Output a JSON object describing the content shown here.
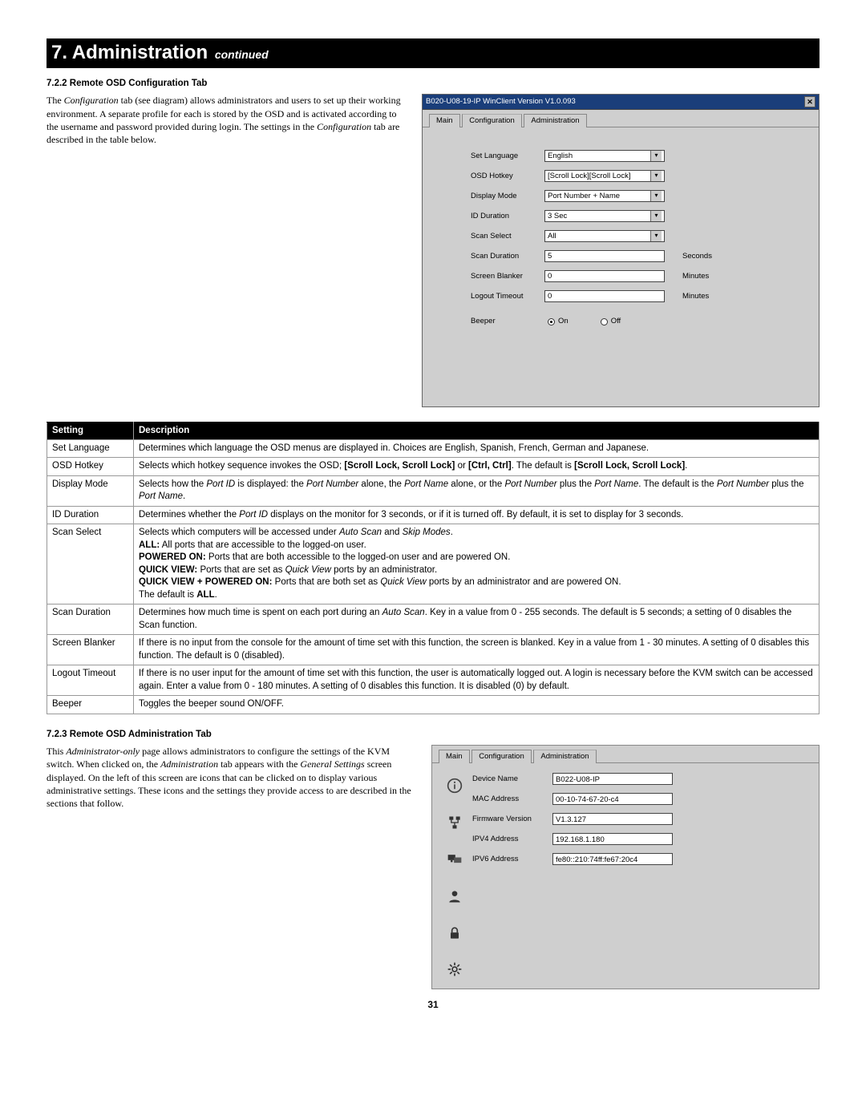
{
  "header": {
    "title": "7. Administration",
    "subtitle": "continued"
  },
  "section1": {
    "heading": "7.2.2 Remote OSD Configuration Tab",
    "paragraph_html": "The <span class=\"ital\">Configuration</span> tab (see diagram) allows administrators and users to set up their working environment. A separate profile for each is stored by the OSD and is activated according to the username and password provided during login. The settings in the <span class=\"ital\">Configuration</span> tab are described in the table below."
  },
  "winclient": {
    "title": "B020-U08-19-IP WinClient Version V1.0.093",
    "tabs": [
      "Main",
      "Configuration",
      "Administration"
    ],
    "active_tab": 1,
    "fields": {
      "set_language": {
        "label": "Set Language",
        "value": "English",
        "type": "select"
      },
      "osd_hotkey": {
        "label": "OSD Hotkey",
        "value": "[Scroll Lock][Scroll Lock]",
        "type": "select"
      },
      "display_mode": {
        "label": "Display Mode",
        "value": "Port Number + Name",
        "type": "select"
      },
      "id_duration": {
        "label": "ID Duration",
        "value": "3 Sec",
        "type": "select"
      },
      "scan_select": {
        "label": "Scan Select",
        "value": "All",
        "type": "select"
      },
      "scan_duration": {
        "label": "Scan Duration",
        "value": "5",
        "type": "input",
        "suffix": "Seconds"
      },
      "screen_blanker": {
        "label": "Screen Blanker",
        "value": "0",
        "type": "input",
        "suffix": "Minutes"
      },
      "logout_timeout": {
        "label": "Logout Timeout",
        "value": "0",
        "type": "input",
        "suffix": "Minutes"
      },
      "beeper": {
        "label": "Beeper",
        "type": "radio",
        "value": "On",
        "options": [
          "On",
          "Off"
        ]
      }
    }
  },
  "settings_table": {
    "headers": [
      "Setting",
      "Description"
    ],
    "rows": [
      {
        "setting": "Set Language",
        "description_html": "Determines which language the OSD menus are displayed in. Choices are English, Spanish, French, German and Japanese."
      },
      {
        "setting": "OSD Hotkey",
        "description_html": "Selects which hotkey sequence invokes the OSD; <b>[Scroll Lock, Scroll Lock]</b> or <b>[Ctrl, Ctrl]</b>. The default is <b>[Scroll Lock, Scroll Lock]</b>."
      },
      {
        "setting": "Display Mode",
        "description_html": "Selects how the <i>Port ID</i> is displayed: the <i>Port Number</i> alone, the <i>Port Name</i> alone, or the <i>Port Number</i> plus the <i>Port Name</i>. The default is the <i>Port Number</i> plus the <i>Port Name</i>."
      },
      {
        "setting": "ID Duration",
        "description_html": "Determines whether the <i>Port ID</i> displays on the monitor for 3 seconds, or if it is turned off. By default, it is set to display for 3 seconds."
      },
      {
        "setting": "Scan Select",
        "description_html": "Selects which computers will be accessed under <i>Auto Scan</i> and <i>Skip Modes</i>.<br><b>ALL:</b> All ports that are accessible to the logged-on user.<br><b>POWERED ON:</b> Ports that are both accessible to the logged-on user and are powered ON.<br><b>QUICK VIEW:</b> Ports that are set as <i>Quick View</i> ports by an administrator.<br><b>QUICK VIEW + POWERED ON:</b> Ports that are both set as <i>Quick View</i> ports by an administrator and are powered ON.<br>The default is <b>ALL</b>."
      },
      {
        "setting": "Scan Duration",
        "description_html": "Determines how much time is spent on each port during an <i>Auto Scan</i>. Key in a value from 0 - 255 seconds. The default is 5 seconds; a setting of 0 disables the Scan function."
      },
      {
        "setting": "Screen Blanker",
        "description_html": "If there is no input from the console for the amount of time set with this function, the screen is blanked. Key in a value from 1 - 30 minutes. A setting of 0 disables this function. The default is 0 (disabled)."
      },
      {
        "setting": "Logout Timeout",
        "description_html": "If there is no user input for the amount of time set with this function, the user is automatically logged out. A login is necessary before the KVM switch can be accessed again. Enter a value from 0 - 180 minutes. A setting of 0 disables this function. It is disabled (0) by default."
      },
      {
        "setting": "Beeper",
        "description_html": "Toggles the beeper sound ON/OFF."
      }
    ]
  },
  "section2": {
    "heading": "7.2.3 Remote OSD Administration Tab",
    "paragraph_html": "This <span class=\"ital\">Administrator-only</span> page allows administrators to configure the settings of the KVM switch. When clicked on, the <span class=\"ital\">Administration</span> tab appears with the <span class=\"ital\">General Settings</span> screen displayed. On the left of this screen are icons that can be clicked on to display various administrative settings. These icons and the settings they provide access to are described in the sections that follow."
  },
  "admin_pane": {
    "tabs": [
      "Main",
      "Configuration",
      "Administration"
    ],
    "active_tab": 2,
    "fields": {
      "device_name": {
        "label": "Device Name",
        "value": "B022-U08-IP"
      },
      "mac_address": {
        "label": "MAC Address",
        "value": "00-10-74-67-20-c4"
      },
      "firmware_version": {
        "label": "Firmware Version",
        "value": "V1.3.127"
      },
      "ipv4_address": {
        "label": "IPV4 Address",
        "value": "192.168.1.180"
      },
      "ipv6_address": {
        "label": "IPV6 Address",
        "value": "fe80::210:74ff:fe67:20c4"
      }
    },
    "icons": [
      "info",
      "network",
      "monitors",
      "user",
      "lock",
      "gear"
    ]
  },
  "page_number": "31"
}
